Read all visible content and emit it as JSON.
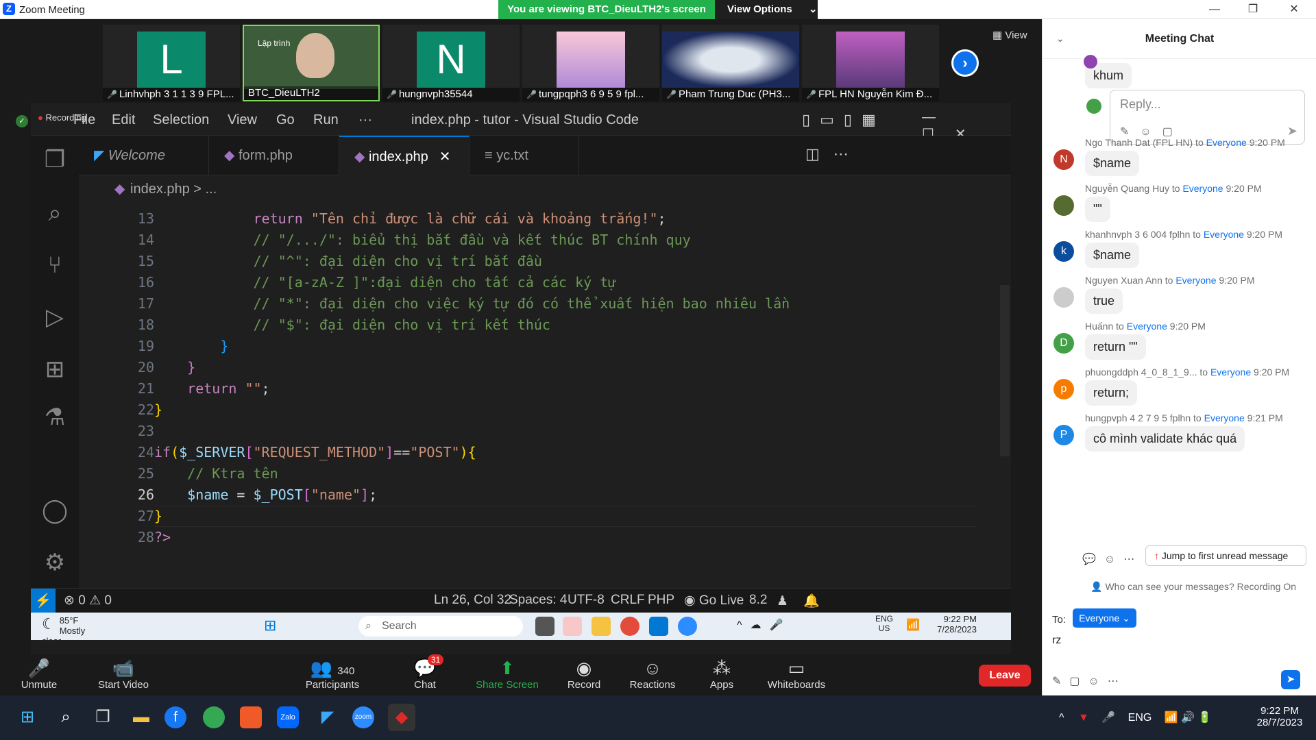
{
  "window": {
    "title": "Zoom Meeting",
    "banner": "You are viewing BTC_DieuLTH2's screen",
    "view_options": "View Options"
  },
  "gallery": {
    "view_label": "View",
    "participants": [
      {
        "initial": "L",
        "name": "Linhvhph 3 1 1 3 9 FPL...",
        "color": "#0a8a6a"
      },
      {
        "initial": "",
        "name": "BTC_DieuLTH2",
        "color": "#3d5c3a",
        "screen_text": "Lập trình"
      },
      {
        "initial": "N",
        "name": "hungnvph35544",
        "color": "#0a8a6a"
      },
      {
        "initial": "",
        "name": "tungpqph3 6 9 5 9 fpl...",
        "color": "#b08ad8"
      },
      {
        "initial": "",
        "name": "Pham Trung Duc (PH3...",
        "color": "#1c2a5a"
      },
      {
        "initial": "",
        "name": "FPL HN Nguyễn Kim Đ...",
        "color": "#5a3a7a"
      }
    ]
  },
  "vscode": {
    "recording": "Recording",
    "menu": [
      "File",
      "Edit",
      "Selection",
      "View",
      "Go",
      "Run",
      "···"
    ],
    "title": "index.php - tutor - Visual Studio Code",
    "tabs": [
      "Welcome",
      "form.php",
      "index.php",
      "yc.txt"
    ],
    "breadcrumb": "index.php > ...",
    "status": {
      "errors": "0",
      "warnings": "0",
      "position": "Ln 26, Col 32",
      "spaces": "Spaces: 4",
      "encoding": "UTF-8",
      "eol": "CRLF",
      "language": "PHP",
      "golive": "Go Live",
      "version": "8.2"
    },
    "lines": [
      {
        "n": "13",
        "segs": [
          {
            "c": "kw",
            "t": "            return "
          },
          {
            "c": "str",
            "t": "\"Tên chỉ được là chữ cái và khoảng trắng!\""
          },
          {
            "c": "op",
            "t": ";"
          }
        ]
      },
      {
        "n": "14",
        "segs": [
          {
            "c": "cm",
            "t": "            // \"/.../\": biểu thị bắt đầu và kết thúc BT chính quy"
          }
        ]
      },
      {
        "n": "15",
        "segs": [
          {
            "c": "cm",
            "t": "            // \"^\": đại diện cho vị trí bắt đầu"
          }
        ]
      },
      {
        "n": "16",
        "segs": [
          {
            "c": "cm",
            "t": "            // \"[a-zA-Z ]\":đại diện cho tất cả các ký tự"
          }
        ]
      },
      {
        "n": "17",
        "segs": [
          {
            "c": "cm",
            "t": "            // \"*\": đại diện cho việc ký tự đó có thể xuất hiện bao nhiêu lần"
          }
        ]
      },
      {
        "n": "18",
        "segs": [
          {
            "c": "cm",
            "t": "            // \"$\": đại diện cho vị trí kết thúc"
          }
        ]
      },
      {
        "n": "19",
        "segs": [
          {
            "c": "br3",
            "t": "        }"
          }
        ]
      },
      {
        "n": "20",
        "segs": [
          {
            "c": "br2",
            "t": "    }"
          }
        ]
      },
      {
        "n": "21",
        "segs": [
          {
            "c": "kw",
            "t": "    return "
          },
          {
            "c": "str",
            "t": "\"\""
          },
          {
            "c": "op",
            "t": ";"
          }
        ]
      },
      {
        "n": "22",
        "segs": [
          {
            "c": "br",
            "t": "}"
          }
        ]
      },
      {
        "n": "23",
        "segs": [
          {
            "c": "op",
            "t": ""
          }
        ]
      },
      {
        "n": "24",
        "segs": [
          {
            "c": "kw",
            "t": "if"
          },
          {
            "c": "br",
            "t": "("
          },
          {
            "c": "vr",
            "t": "$_SERVER"
          },
          {
            "c": "br2",
            "t": "["
          },
          {
            "c": "str",
            "t": "\"REQUEST_METHOD\""
          },
          {
            "c": "br2",
            "t": "]"
          },
          {
            "c": "op",
            "t": "=="
          },
          {
            "c": "str",
            "t": "\"POST\""
          },
          {
            "c": "br",
            "t": "){"
          }
        ]
      },
      {
        "n": "25",
        "segs": [
          {
            "c": "cm",
            "t": "    // Ktra tên"
          }
        ]
      },
      {
        "n": "26",
        "segs": [
          {
            "c": "vr",
            "t": "    $name"
          },
          {
            "c": "op",
            "t": " = "
          },
          {
            "c": "vr",
            "t": "$_POST"
          },
          {
            "c": "br2",
            "t": "["
          },
          {
            "c": "str",
            "t": "\"name\""
          },
          {
            "c": "br2",
            "t": "]"
          },
          {
            "c": "op",
            "t": ";"
          }
        ]
      },
      {
        "n": "27",
        "segs": [
          {
            "c": "br",
            "t": "}"
          }
        ]
      },
      {
        "n": "28",
        "segs": [
          {
            "c": "kw",
            "t": "?>"
          }
        ]
      }
    ]
  },
  "remote_taskbar": {
    "temp": "85°F",
    "weather": "Mostly clear",
    "search": "Search",
    "lang": "ENG",
    "region": "US",
    "time": "9:22 PM",
    "date": "7/28/2023"
  },
  "controls": {
    "unmute": "Unmute",
    "start_video": "Start Video",
    "participants": "Participants",
    "participants_count": "340",
    "chat": "Chat",
    "chat_badge": "31",
    "share": "Share Screen",
    "record": "Record",
    "reactions": "Reactions",
    "apps": "Apps",
    "whiteboards": "Whiteboards",
    "leave": "Leave"
  },
  "chat": {
    "title": "Meeting Chat",
    "top_message": "khum",
    "reply_placeholder": "Reply...",
    "messages": [
      {
        "initial": "N",
        "color": "#c0392b",
        "from": "Ngo Thanh Dat (FPL HN)",
        "to": "Everyone",
        "time": "9:20 PM",
        "text": "$name"
      },
      {
        "initial": "",
        "color": "#556b2f",
        "from": "Nguyễn Quang Huy",
        "to": "Everyone",
        "time": "9:20 PM",
        "text": "\"\""
      },
      {
        "initial": "k",
        "color": "#0b4c9c",
        "from": "khanhnvph 3 6 004 fplhn",
        "to": "Everyone",
        "time": "9:20 PM",
        "text": "$name"
      },
      {
        "initial": "",
        "color": "#cccccc",
        "from": "Nguyen Xuan Ann",
        "to": "Everyone",
        "time": "9:20 PM",
        "text": "true"
      },
      {
        "initial": "D",
        "color": "#43a047",
        "from": "Huấnn",
        "to": "Everyone",
        "time": "9:20 PM",
        "text": "return \"\""
      },
      {
        "initial": "p",
        "color": "#f57c00",
        "from": "phuongddph 4_0_8_1_9...",
        "to": "Everyone",
        "time": "9:20 PM",
        "text": "return;"
      },
      {
        "initial": "P",
        "color": "#1e88e5",
        "from": "hungpvph 4 2 7 9 5 fplhn",
        "to": "Everyone",
        "time": "9:21 PM",
        "text": "cô mình validate khác quá"
      }
    ],
    "jump": "Jump to first unread message",
    "who_can_see": "Who can see your messages? Recording On",
    "to_label": "To:",
    "to_value": "Everyone",
    "draft": "rz"
  },
  "taskbar": {
    "lang": "ENG",
    "time": "9:22 PM",
    "date": "28/7/2023"
  }
}
